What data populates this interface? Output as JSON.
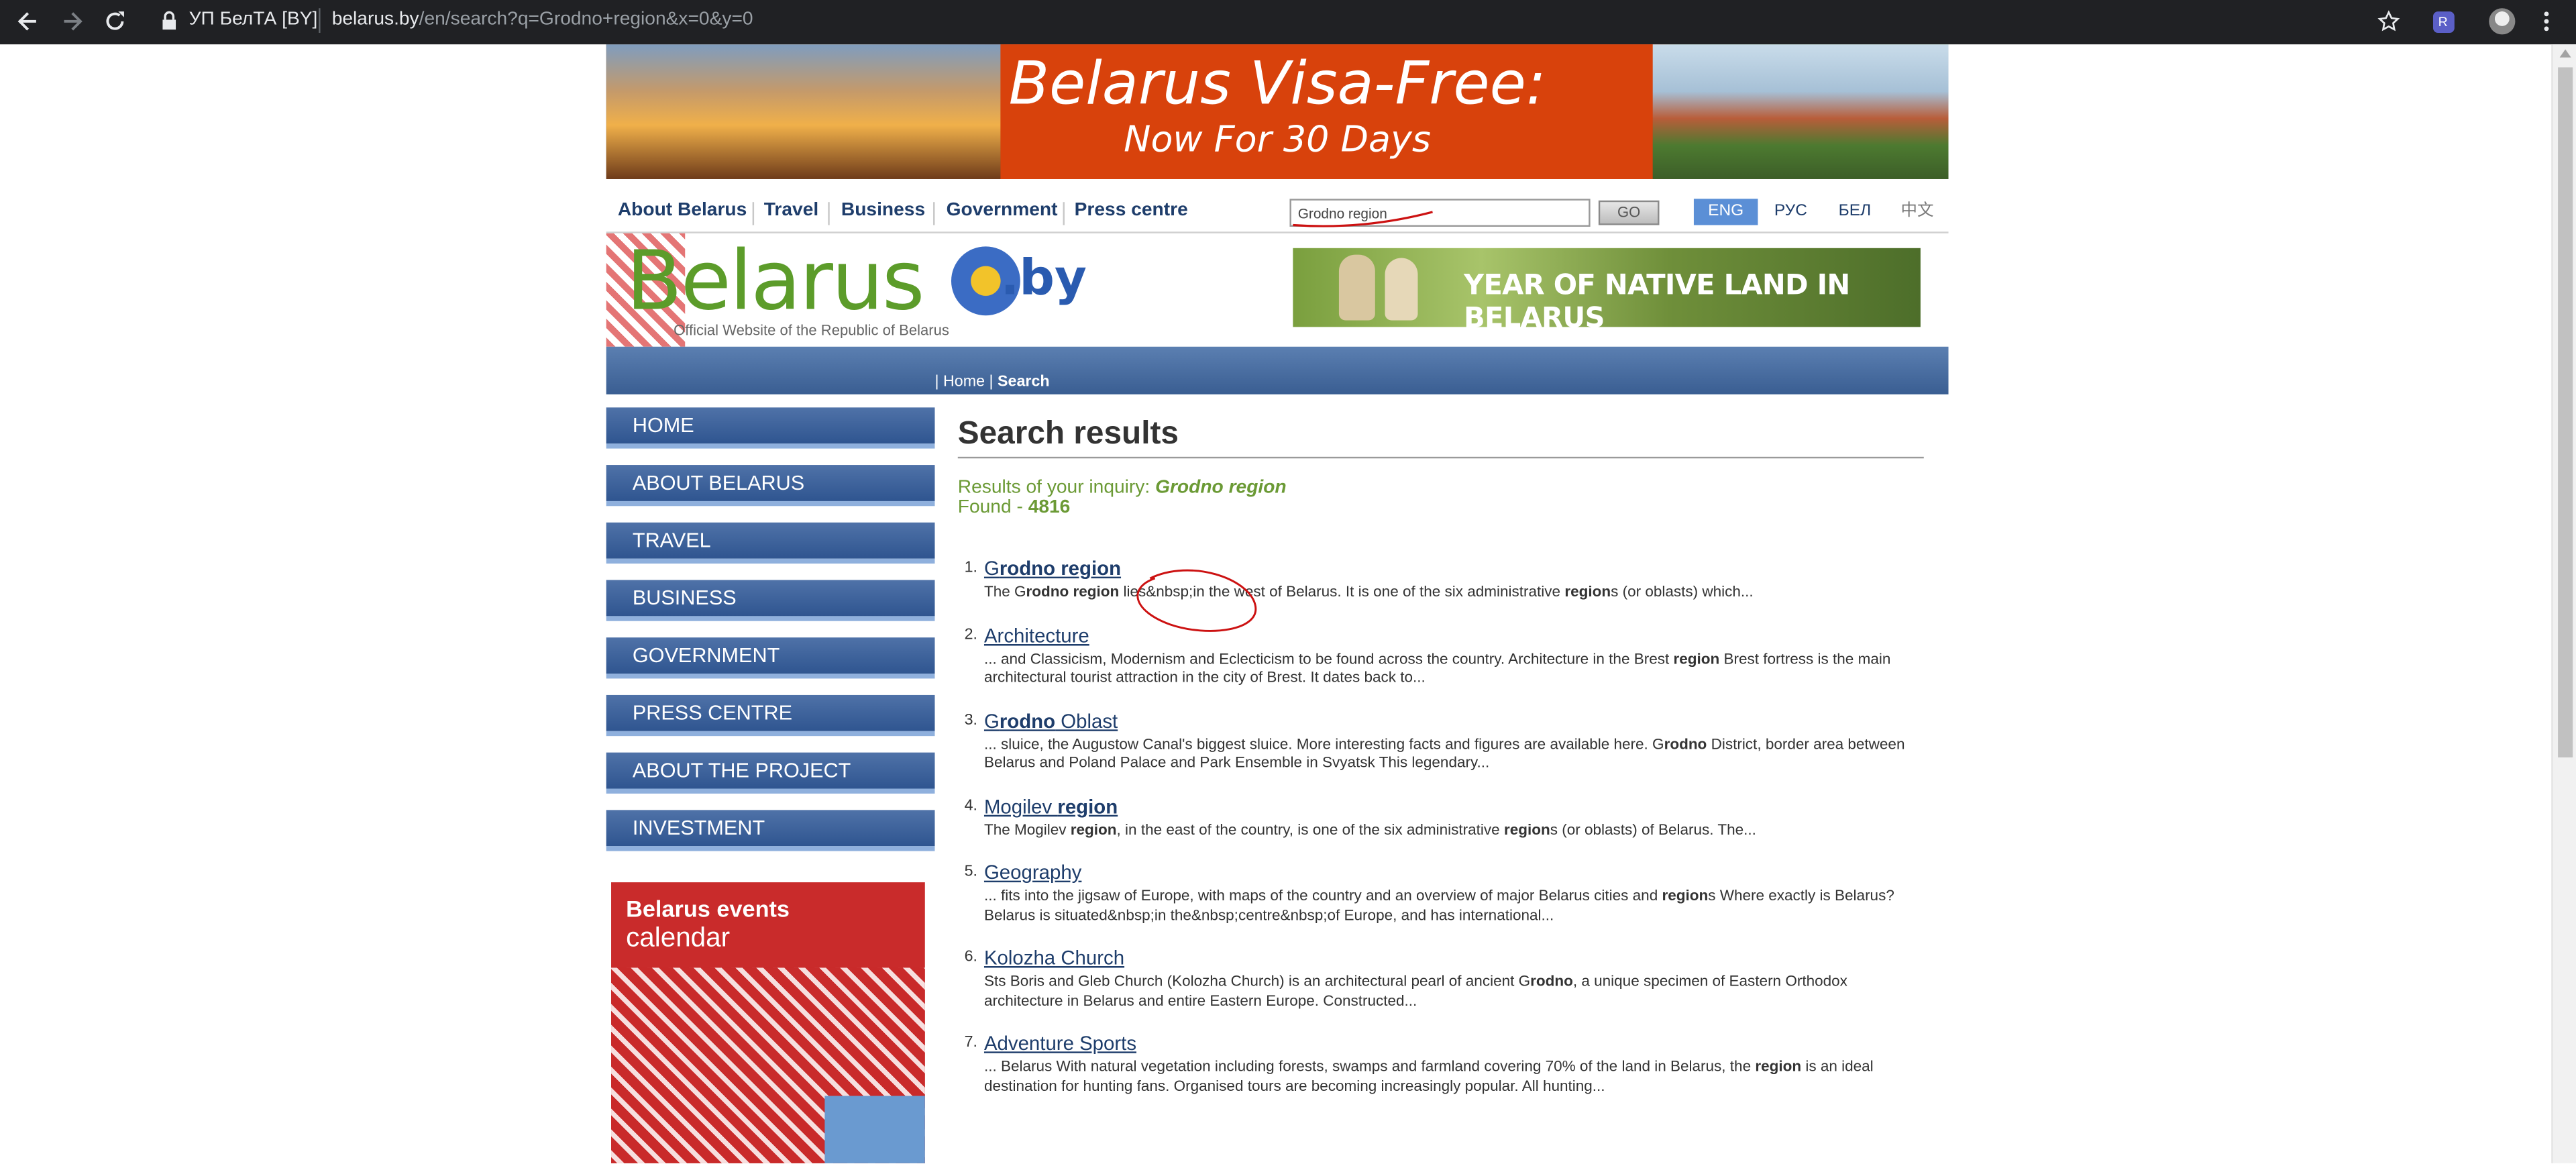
{
  "browser": {
    "site_identity": "УП БелТА [BY]",
    "url_host": "belarus.by",
    "url_path": "/en/search?q=Grodno+region&x=0&y=0",
    "profile_badge": "R"
  },
  "banner": {
    "line1": "Belarus Visa-Free:",
    "line2": "Now For 30 Days"
  },
  "topnav": {
    "items": [
      "About Belarus",
      "Travel",
      "Business",
      "Government",
      "Press centre"
    ],
    "search_value": "Grodno region",
    "go_label": "GO",
    "langs": [
      "ENG",
      "РУС",
      "БЕЛ",
      "中文"
    ]
  },
  "logo": {
    "word": "Belarus",
    "by": ".by",
    "tagline": "Official Website of the Republic of Belarus"
  },
  "year_banner": {
    "text": "YEAR OF NATIVE LAND IN BELARUS"
  },
  "breadcrumb": {
    "home": "Home",
    "current": "Search"
  },
  "sidebar": {
    "items": [
      "HOME",
      "ABOUT BELARUS",
      "TRAVEL",
      "BUSINESS",
      "GOVERNMENT",
      "PRESS CENTRE",
      "ABOUT THE PROJECT",
      "INVESTMENT"
    ],
    "events_title": "Belarus events",
    "events_sub": "calendar"
  },
  "main": {
    "heading": "Search results",
    "inquiry_label": "Results of your inquiry:",
    "inquiry_term": "Grodno region",
    "found_label": "Found -",
    "found_count": "4816"
  },
  "results": [
    {
      "num": "1.",
      "title": [
        [
          "G",
          0
        ],
        [
          "rodno region",
          1
        ]
      ],
      "snippet": [
        [
          "The G",
          0
        ],
        [
          "rodno region",
          1
        ],
        [
          " lies&nbsp;in the west of Belarus. It is one of the six administrative ",
          0
        ],
        [
          "region",
          1
        ],
        [
          "s (or oblasts) which...",
          0
        ]
      ]
    },
    {
      "num": "2.",
      "title": [
        [
          "Architecture",
          0
        ]
      ],
      "snippet": [
        [
          "... and Classicism, Modernism and Eclecticism to be found across the country. Architecture in the Brest ",
          0
        ],
        [
          "region",
          1
        ],
        [
          " Brest fortress is the main architectural tourist attraction in the city of Brest. It dates back to...",
          0
        ]
      ]
    },
    {
      "num": "3.",
      "title": [
        [
          "G",
          0
        ],
        [
          "rodno",
          1
        ],
        [
          " Oblast",
          0
        ]
      ],
      "snippet": [
        [
          "... sluice, the Augustow Canal's biggest sluice. More interesting facts and figures are available here. G",
          0
        ],
        [
          "rodno",
          1
        ],
        [
          " District, border area between Belarus and Poland Palace and Park Ensemble in Svyatsk This legendary...",
          0
        ]
      ]
    },
    {
      "num": "4.",
      "title": [
        [
          "Mogilev ",
          0
        ],
        [
          "region",
          1
        ]
      ],
      "snippet": [
        [
          "The Mogilev ",
          0
        ],
        [
          "region",
          1
        ],
        [
          ", in the east of the country, is one of the six administrative ",
          0
        ],
        [
          "region",
          1
        ],
        [
          "s (or oblasts) of Belarus. The...",
          0
        ]
      ]
    },
    {
      "num": "5.",
      "title": [
        [
          "Geography",
          0
        ]
      ],
      "snippet": [
        [
          "... fits into the jigsaw of Europe, with maps of the country and an overview of major Belarus cities and ",
          0
        ],
        [
          "region",
          1
        ],
        [
          "s Where exactly is Belarus? Belarus is situated&nbsp;in the&nbsp;centre&nbsp;of Europe, and has international...",
          0
        ]
      ]
    },
    {
      "num": "6.",
      "title": [
        [
          "Kolozha Church",
          0
        ]
      ],
      "snippet": [
        [
          "Sts Boris and Gleb Church (Kolozha Church) is an architectural pearl of ancient G",
          0
        ],
        [
          "rodno",
          1
        ],
        [
          ", a unique specimen of Eastern Orthodox architecture in Belarus and entire Eastern Europe. Constructed...",
          0
        ]
      ]
    },
    {
      "num": "7.",
      "title": [
        [
          "Adventure Sports",
          0
        ]
      ],
      "snippet": [
        [
          "... Belarus With natural vegetation including forests, swamps and farmland covering 70% of the land in Belarus, the ",
          0
        ],
        [
          "region",
          1
        ],
        [
          " is an ideal destination for hunting fans. Organised tours are becoming increasingly popular. All hunting...",
          0
        ]
      ]
    }
  ],
  "colors": {
    "chrome_bg": "#202124",
    "nav_blue": "#1e3d6b",
    "menu_blue": "#2f5590",
    "green_text": "#6b9a35",
    "annotation_red": "#cc1111"
  }
}
